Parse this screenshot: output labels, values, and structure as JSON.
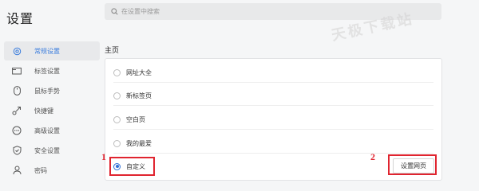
{
  "header": {
    "title": "设置",
    "search_placeholder": "在设置中搜索",
    "search_value": "",
    "watermark": "天极下载站"
  },
  "sidebar": {
    "items": [
      {
        "label": "常规设置",
        "icon": "gear-icon",
        "active": true
      },
      {
        "label": "标签设置",
        "icon": "tab-icon",
        "active": false
      },
      {
        "label": "鼠标手势",
        "icon": "mouse-icon",
        "active": false
      },
      {
        "label": "快捷键",
        "icon": "shortcut-icon",
        "active": false
      },
      {
        "label": "高级设置",
        "icon": "more-icon",
        "active": false
      },
      {
        "label": "安全设置",
        "icon": "shield-icon",
        "active": false
      },
      {
        "label": "密码",
        "icon": "user-icon",
        "active": false
      }
    ]
  },
  "homepage": {
    "section_title": "主页",
    "options": [
      {
        "label": "网址大全",
        "checked": false
      },
      {
        "label": "新标签页",
        "checked": false
      },
      {
        "label": "空白页",
        "checked": false
      },
      {
        "label": "我的最爱",
        "checked": false
      },
      {
        "label": "自定义",
        "checked": true
      }
    ],
    "set_button_label": "设置网页"
  },
  "annotations": {
    "step1": "1",
    "step2": "2",
    "color": "#e0242f"
  },
  "colors": {
    "accent": "#2f6fd6",
    "active_text": "#3b7ddd"
  }
}
